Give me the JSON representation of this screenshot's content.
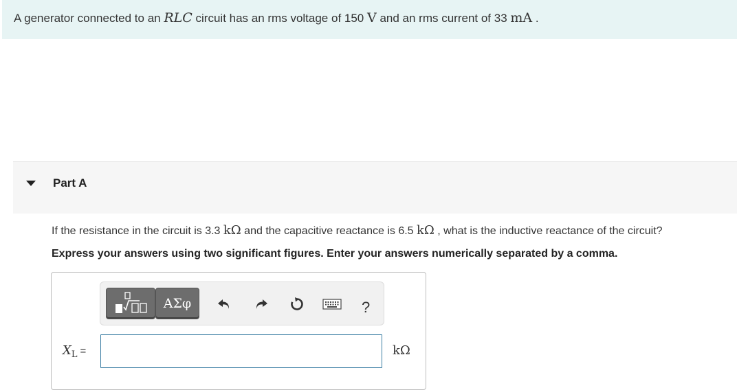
{
  "intro": {
    "text_1": "A generator connected to an ",
    "circuit": "RLC",
    "text_2": " circuit has an rms voltage of 150 ",
    "unit_v": "V",
    "text_3": " and an rms current of 33 ",
    "unit_ma": "mA",
    "text_4": " ."
  },
  "part": {
    "title": "Part A"
  },
  "question": {
    "text_1": "If the resistance in the circuit is 3.3 ",
    "unit_1": "kΩ",
    "text_2": " and the capacitive reactance is 6.5 ",
    "unit_2": "kΩ",
    "text_3": " , what is the inductive reactance of the circuit?"
  },
  "instruction": "Express your answers using two significant figures. Enter your answers numerically separated by a comma.",
  "toolbar": {
    "greek_label": "ΑΣφ",
    "help_label": "?",
    "icons": [
      "templates-icon",
      "greek-symbols-icon",
      "undo-icon",
      "redo-icon",
      "reset-icon",
      "keyboard-icon",
      "help-icon"
    ]
  },
  "answer": {
    "symbol": "X",
    "subscript": "L",
    "equals": "=",
    "value": "",
    "placeholder": "",
    "unit": "kΩ"
  },
  "colors": {
    "intro_bg": "#e7f4f4",
    "part_header_bg": "#f6f6f6",
    "input_border": "#3a7da3",
    "button_dark": "#6d6d6d"
  }
}
